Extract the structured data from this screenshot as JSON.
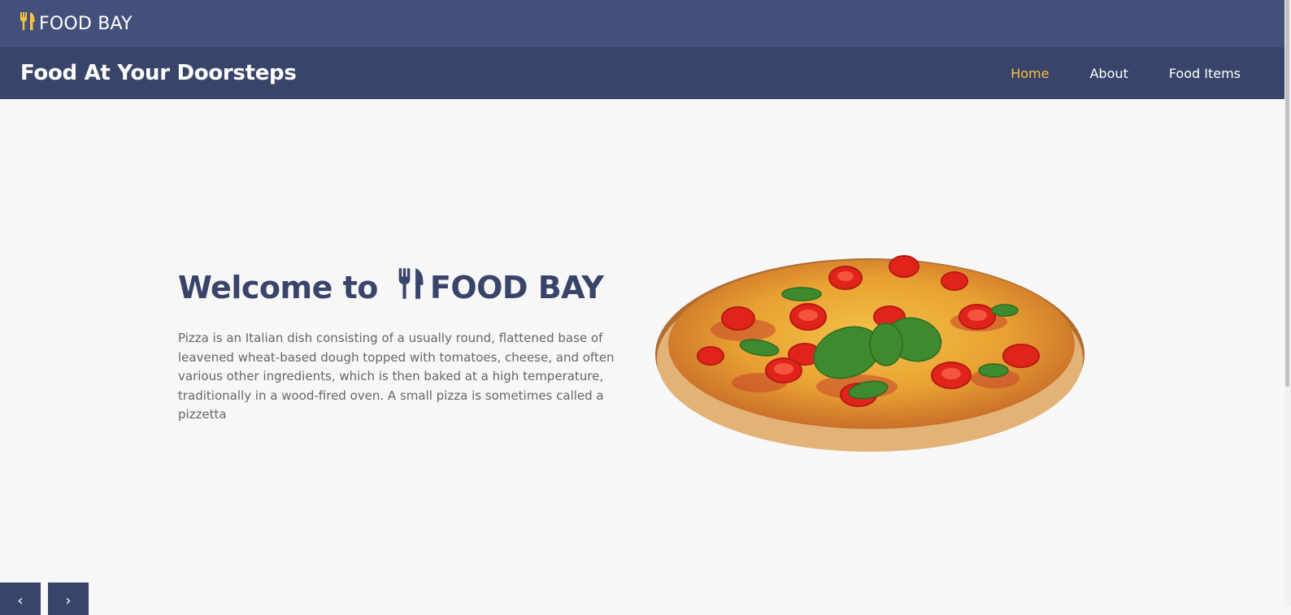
{
  "topbar": {
    "brand": "FOOD BAY",
    "brand_icon": "utensils-icon",
    "brand_icon_color": "#f7c23c",
    "background": "#43507a"
  },
  "navbar": {
    "tagline": "Food At Your Doorsteps",
    "links": [
      {
        "label": "Home",
        "active": true
      },
      {
        "label": "About",
        "active": false
      },
      {
        "label": "Food Items",
        "active": false
      }
    ],
    "active_color": "#f7c23c",
    "background": "#39446a"
  },
  "hero": {
    "title_prefix": "Welcome to",
    "title_brand": "FOOD BAY",
    "title_icon": "utensils-icon",
    "description": "Pizza is an Italian dish consisting of a usually round, flattened base of leavened wheat-based dough topped with tomatoes, cheese, and often various other ingredients, which is then baked at a high temperature, traditionally in a wood-fired oven. A small pizza is sometimes called a pizzetta",
    "image": "pizza-image"
  },
  "carousel": {
    "prev_icon": "chevron-left-icon",
    "next_icon": "chevron-right-icon",
    "prev_glyph": "‹",
    "next_glyph": "›"
  }
}
